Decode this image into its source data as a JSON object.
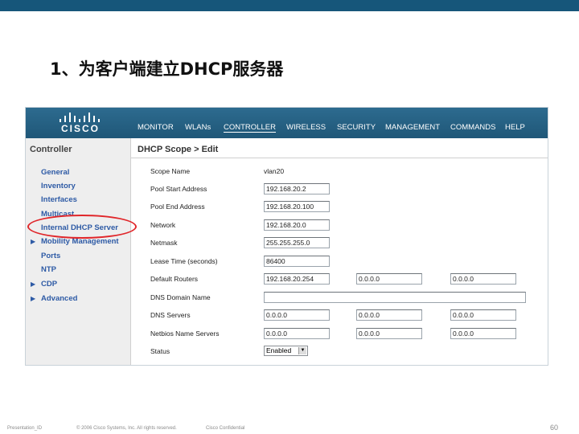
{
  "slide": {
    "title": "1、为客户端建立DHCP服务器",
    "footer_left": "Presentation_ID",
    "footer_copyright": "© 2006 Cisco Systems, Inc. All rights reserved.",
    "footer_confidential": "Cisco Confidential",
    "page_number": "60"
  },
  "app": {
    "logo_text": "CISCO",
    "menu": [
      "MONITOR",
      "WLANs",
      "CONTROLLER",
      "WIRELESS",
      "SECURITY",
      "MANAGEMENT",
      "COMMANDS",
      "HELP"
    ],
    "active_menu": "CONTROLLER",
    "colors": {
      "navbar": "#1f5778",
      "link": "#2d5aa5",
      "highlight": "#e0262a",
      "slide_bar": "#16567a"
    }
  },
  "sidebar": {
    "title": "Controller",
    "items": [
      {
        "label": "General",
        "expandable": false
      },
      {
        "label": "Inventory",
        "expandable": false
      },
      {
        "label": "Interfaces",
        "expandable": false
      },
      {
        "label": "Multicast",
        "expandable": false
      },
      {
        "label": "Internal DHCP Server",
        "expandable": false
      },
      {
        "label": "Mobility Management",
        "expandable": true
      },
      {
        "label": "Ports",
        "expandable": false
      },
      {
        "label": "NTP",
        "expandable": false
      },
      {
        "label": "CDP",
        "expandable": true
      },
      {
        "label": "Advanced",
        "expandable": true
      }
    ],
    "highlighted_item": "Internal DHCP Server"
  },
  "form": {
    "breadcrumb": "DHCP Scope > Edit",
    "scope_name_label": "Scope Name",
    "scope_name_value": "vlan20",
    "pool_start_label": "Pool Start Address",
    "pool_start_value": "192.168.20.2",
    "pool_end_label": "Pool End Address",
    "pool_end_value": "192.168.20.100",
    "network_label": "Network",
    "network_value": "192.168.20.0",
    "netmask_label": "Netmask",
    "netmask_value": "255.255.255.0",
    "lease_label": "Lease Time (seconds)",
    "lease_value": "86400",
    "routers_label": "Default Routers",
    "routers_values": [
      "192.168.20.254",
      "0.0.0.0",
      "0.0.0.0"
    ],
    "dns_domain_label": "DNS Domain Name",
    "dns_domain_value": "",
    "dns_servers_label": "DNS Servers",
    "dns_servers_values": [
      "0.0.0.0",
      "0.0.0.0",
      "0.0.0.0"
    ],
    "netbios_label": "Netbios Name Servers",
    "netbios_values": [
      "0.0.0.0",
      "0.0.0.0",
      "0.0.0.0"
    ],
    "status_label": "Status",
    "status_value": "Enabled"
  }
}
